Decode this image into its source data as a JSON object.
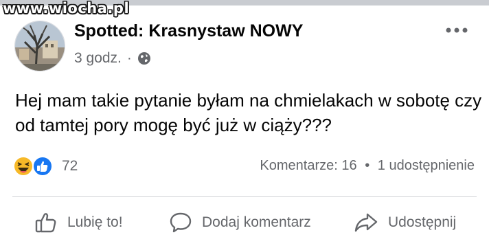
{
  "watermark": "www.wiocha.pl",
  "post": {
    "page_name": "Spotted: Krasnystaw NOWY",
    "time": "3 godz.",
    "dot": "·",
    "privacy_icon": "globe-icon",
    "text": "Hej mam takie pytanie byłam na chmielakach w sobotę czy od tamtej pory mogę być już w ciąży???"
  },
  "reactions": {
    "icons": [
      "haha-emoji-icon",
      "like-reaction-icon"
    ],
    "count": "72"
  },
  "stats": {
    "comments": "Komentarze: 16",
    "separator": "•",
    "shares": "1 udostępnienie"
  },
  "actions": {
    "like": "Lubię to!",
    "comment": "Dodaj komentarz",
    "share": "Udostępnij"
  },
  "colors": {
    "secondary_text": "#65676b",
    "like_blue": "#1877f2",
    "haha_yellow": "#f7b928",
    "divider": "#ced0d4"
  }
}
